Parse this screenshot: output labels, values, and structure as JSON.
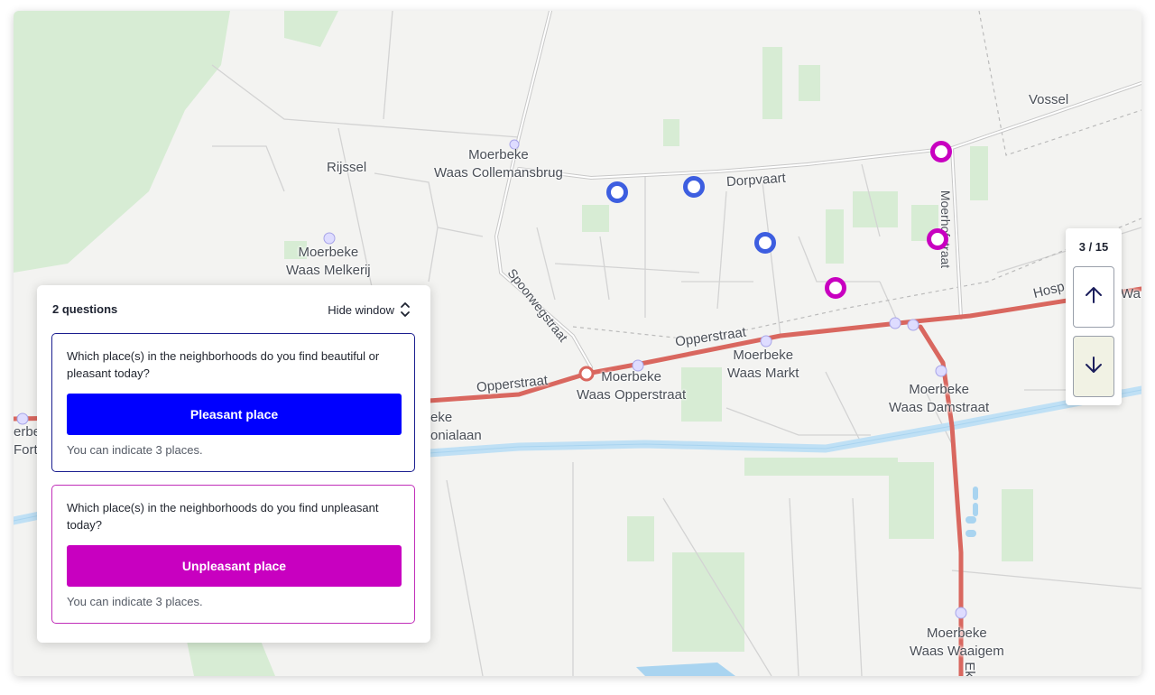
{
  "map": {
    "place_labels": [
      {
        "id": "vossel",
        "text": "Vossel"
      },
      {
        "id": "rijssel",
        "text": "Rijssel"
      },
      {
        "id": "collemansbrug",
        "text": "Moerbeke\nWaas Collemansbrug"
      },
      {
        "id": "dorpvaart",
        "text": "Dorpvaart"
      },
      {
        "id": "melkerij",
        "text": "Moerbeke\nWaas Melkerij"
      },
      {
        "id": "spoorwegstraat",
        "text": "Spoorwegstraat"
      },
      {
        "id": "opperstraat1",
        "text": "Opperstraat"
      },
      {
        "id": "opperstraat2",
        "text": "Opperstraat"
      },
      {
        "id": "waas-opperstraat",
        "text": "Moerbeke\nWaas Opperstraat"
      },
      {
        "id": "waas-markt",
        "text": "Moerbeke\nWaas Markt"
      },
      {
        "id": "waas-damstraat",
        "text": "Moerbeke\nWaas Damstraat"
      },
      {
        "id": "moerhofstraat",
        "text": "Moerhofstraat"
      },
      {
        "id": "hosp",
        "text": "Hosp"
      },
      {
        "id": "wa",
        "text": "Wa"
      },
      {
        "id": "eke",
        "text": "eke"
      },
      {
        "id": "onialaan",
        "text": "onialaan"
      },
      {
        "id": "erbe",
        "text": "erbe"
      },
      {
        "id": "fort",
        "text": "Fort"
      },
      {
        "id": "waas-waaigem",
        "text": "Moerbeke\nWaas Waaigem"
      },
      {
        "id": "ek",
        "text": "Ek"
      }
    ],
    "pins": [
      {
        "type": "pleasant"
      },
      {
        "type": "pleasant"
      },
      {
        "type": "pleasant"
      },
      {
        "type": "unpleasant"
      },
      {
        "type": "unpleasant"
      },
      {
        "type": "unpleasant"
      }
    ],
    "colors": {
      "pleasant": "#3d5ee0",
      "unpleasant": "#c800c0",
      "road_main": "#d9675f",
      "canal": "#bfe0f5",
      "green": "#d7ecd4"
    }
  },
  "panel": {
    "title": "2 questions",
    "hide_label": "Hide window",
    "questions": [
      {
        "text": "Which place(s) in the neighborhoods do you find beautiful or pleasant today?",
        "button": "Pleasant place",
        "hint": "You can indicate 3 places.",
        "color": "#0000ff"
      },
      {
        "text": "Which place(s) in the neighborhoods do you find unpleasant today?",
        "button": "Unpleasant place",
        "hint": "You can indicate 3 places.",
        "color": "#c800c0"
      }
    ]
  },
  "pager": {
    "count": "3 / 15",
    "up_icon": "arrow-up-icon",
    "down_icon": "arrow-down-icon"
  }
}
